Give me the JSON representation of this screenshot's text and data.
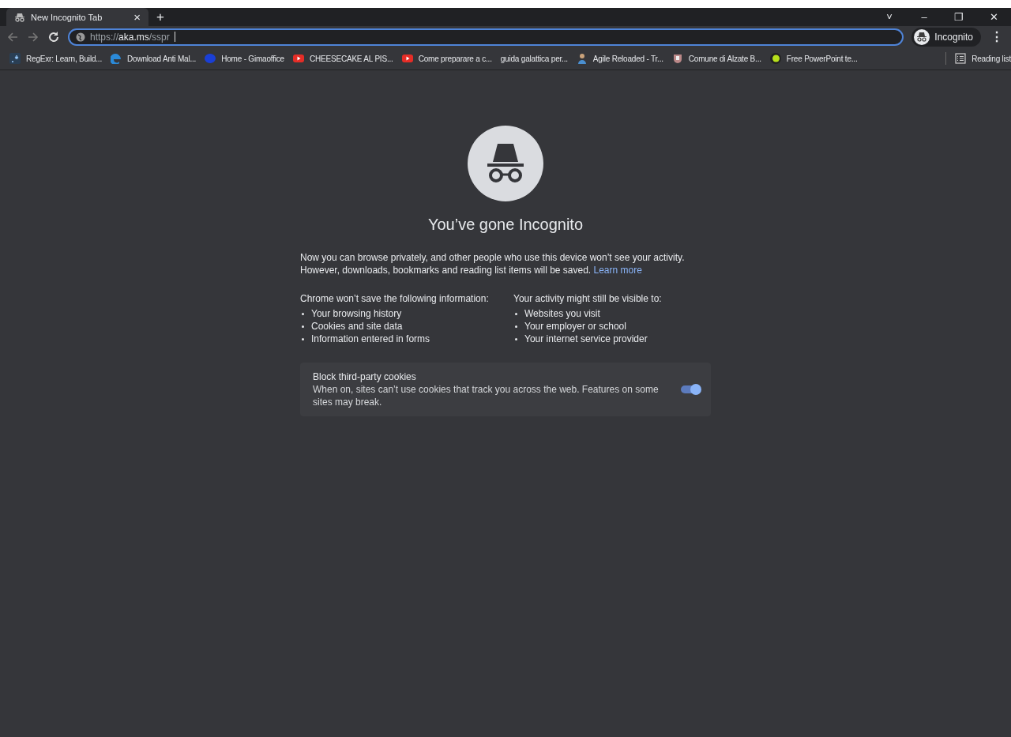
{
  "tabs": [
    {
      "title": "New Incognito Tab",
      "close": "×",
      "selected": true
    }
  ],
  "new_tab": "+",
  "window_controls": [
    "˅",
    "–",
    "❐",
    "✕"
  ],
  "address_bar": {
    "scheme": "https://",
    "host": "aka.ms",
    "path": "/sspr",
    "focused": true
  },
  "profile": {
    "label": "Incognito"
  },
  "menu": "⋮",
  "bookmarks": [
    {
      "label": "RegExr: Learn, Build...",
      "kind": "regex"
    },
    {
      "label": "Download Anti Mal...",
      "kind": "edge"
    },
    {
      "label": "Home - Gimaoffice",
      "kind": "blue"
    },
    {
      "label": "CHEESECAKE AL PIS...",
      "kind": "youtube"
    },
    {
      "label": "Come preparare a c...",
      "kind": "youtube"
    },
    {
      "label": "guida galattica per...",
      "kind": "none"
    },
    {
      "label": "Agile Reloaded - Tr...",
      "kind": "person"
    },
    {
      "label": "Comune di Alzate B...",
      "kind": "crest"
    },
    {
      "label": "Free PowerPoint te...",
      "kind": "lime"
    }
  ],
  "reading_list": "Reading list",
  "page": {
    "heading": "You’ve gone Incognito",
    "intro_1": "Now you can browse privately, and other people who use this device won’t see your activity.",
    "intro_2": "However, downloads, bookmarks and reading list items will be saved.",
    "learn_more": "Learn more",
    "columns": [
      {
        "title": "Chrome won’t save the following information:",
        "items": [
          "Your browsing history",
          "Cookies and site data",
          "Information entered in forms"
        ]
      },
      {
        "title": "Your activity might still be visible to:",
        "items": [
          "Websites you visit",
          "Your employer or school",
          "Your internet service provider"
        ]
      }
    ],
    "cookies_card": {
      "title": "Block third-party cookies",
      "text": "When on, sites can’t use cookies that track you across the web. Features on some sites may break.",
      "on": true
    }
  }
}
